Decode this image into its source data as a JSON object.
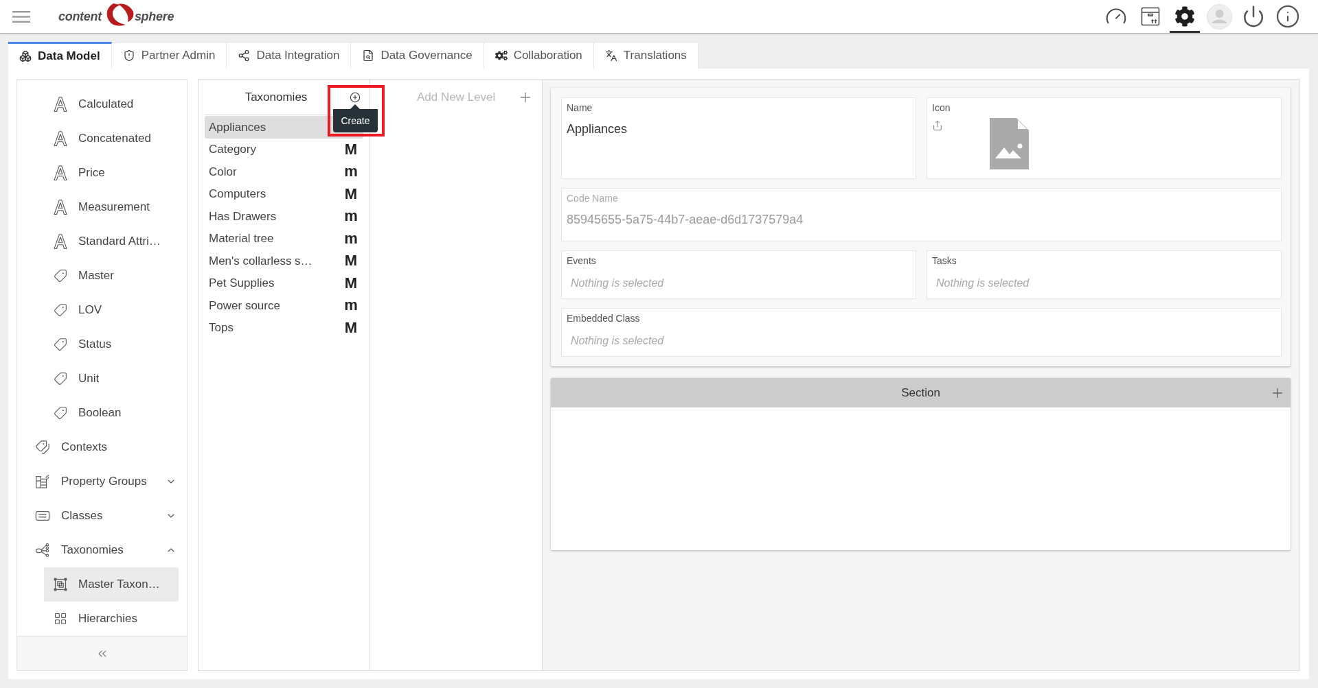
{
  "header": {
    "logo": {
      "left_text": "content",
      "right_text": "sphere"
    },
    "toolbar": [
      {
        "selected": false
      },
      {
        "selected": false
      },
      {
        "selected": true
      },
      {
        "selected": false
      },
      {
        "selected": false
      },
      {
        "selected": false
      }
    ]
  },
  "tabs": [
    {
      "label": "Data Model",
      "selected": true
    },
    {
      "label": "Partner Admin",
      "selected": false
    },
    {
      "label": "Data Integration",
      "selected": false
    },
    {
      "label": "Data Governance",
      "selected": false
    },
    {
      "label": "Collaboration",
      "selected": false
    },
    {
      "label": "Translations",
      "selected": false
    }
  ],
  "sidebar": {
    "group_children": [
      {
        "kind": "attribute",
        "label": "Calculated",
        "selected": false
      },
      {
        "kind": "attribute",
        "label": "Concatenated",
        "selected": false
      },
      {
        "kind": "attribute",
        "label": "Price",
        "selected": false
      },
      {
        "kind": "attribute",
        "label": "Measurement",
        "selected": false
      },
      {
        "kind": "attribute",
        "label": "Standard Attri…",
        "selected": false
      },
      {
        "kind": "list",
        "label": "Master",
        "selected": false
      },
      {
        "kind": "list",
        "label": "LOV",
        "selected": false
      },
      {
        "kind": "list",
        "label": "Status",
        "selected": false
      },
      {
        "kind": "list",
        "label": "Unit",
        "selected": false
      },
      {
        "kind": "list",
        "label": "Boolean",
        "selected": false
      }
    ],
    "items": [
      {
        "kind": "contexts",
        "label": "Contexts",
        "selected": false
      },
      {
        "kind": "groups",
        "label": "Property Groups",
        "selected": false,
        "expanded": false
      },
      {
        "kind": "classes",
        "label": "Classes",
        "selected": false,
        "expanded": false
      },
      {
        "kind": "taxonomies",
        "label": "Taxonomies",
        "selected": false,
        "expanded": true,
        "children": [
          {
            "kind": "taxonomy",
            "label": "Master Taxon…",
            "selected": true
          },
          {
            "kind": "hierarchy",
            "label": "Hierarchies",
            "selected": false
          }
        ]
      }
    ]
  },
  "taxonomies": {
    "title": "Taxonomies",
    "tooltip": "Create",
    "items": [
      {
        "label": "Appliances",
        "selected": true
      },
      {
        "label": "Category",
        "badge": "M",
        "selected": false
      },
      {
        "label": "Color",
        "badge": "m",
        "selected": false
      },
      {
        "label": "Computers",
        "badge": "M",
        "selected": false
      },
      {
        "label": "Has Drawers",
        "badge": "m",
        "selected": false
      },
      {
        "label": "Material tree",
        "badge": "m",
        "selected": false
      },
      {
        "label": "Men's collarless s…",
        "badge": "M",
        "selected": false
      },
      {
        "label": "Pet Supplies",
        "badge": "M",
        "selected": false
      },
      {
        "label": "Power source",
        "badge": "m",
        "selected": false
      },
      {
        "label": "Tops",
        "badge": "M",
        "selected": false
      }
    ]
  },
  "levels": {
    "title": "Add New Level"
  },
  "details": {
    "name": {
      "label": "Name",
      "value": "Appliances",
      "disabled": false
    },
    "icon": {
      "label": "Icon"
    },
    "code_name": {
      "label": "Code Name",
      "value": "85945655-5a75-44b7-aeae-d6d1737579a4",
      "disabled": true
    },
    "events": {
      "label": "Events",
      "placeholder": "Nothing is selected"
    },
    "tasks": {
      "label": "Tasks",
      "placeholder": "Nothing is selected"
    },
    "embedded_class": {
      "label": "Embedded Class",
      "placeholder": "Nothing is selected"
    }
  },
  "section": {
    "title": "Section"
  }
}
